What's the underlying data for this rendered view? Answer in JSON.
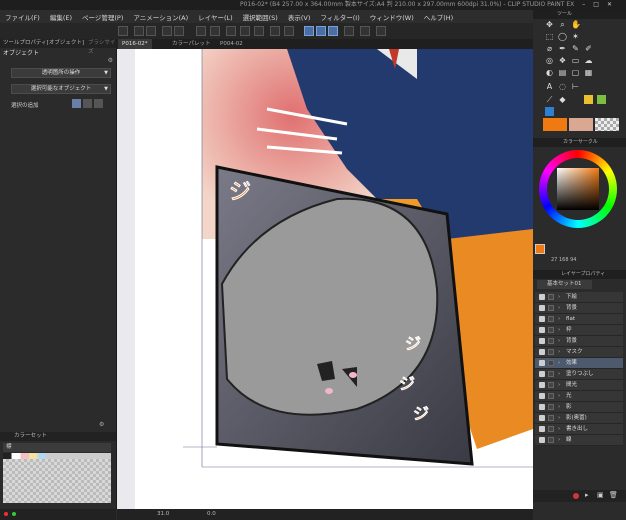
{
  "window": {
    "title": "P016-02* (B4 257.00 x 364.00mm 製本サイズ:A4 判 210.00 x 297.00mm 600dpi 31.0%) - CLIP STUDIO PAINT EX"
  },
  "menu": [
    "ファイル(F)",
    "編集(E)",
    "ページ管理(P)",
    "アニメーション(A)",
    "レイヤー(L)",
    "選択範囲(S)",
    "表示(V)",
    "フィルター(I)",
    "ウィンドウ(W)",
    "ヘルプ(H)"
  ],
  "tabs": [
    "P016-02*",
    "カラーパレット",
    "P004-02"
  ],
  "left_panel": {
    "tab_tool_property": "ツールプロパティ[オブジェクト]",
    "tab_other": "ブラシサイズ",
    "section_title": "オブジェクト",
    "dropdown1": "透明箇所の操作",
    "dropdown2": "選択可能なオブジェクト",
    "selection_add_label": "選択の追加",
    "colorset_tab": "カラーセット",
    "colorset_name": "標"
  },
  "right_panel": {
    "tool_title": "ツール",
    "color_circle_title": "カラーサークル",
    "hsv_values": "27 168 94",
    "layer_title": "レイヤープロパティ",
    "layer_set": "基本セット01",
    "layers": [
      "下絵",
      "背景",
      "flat",
      "枠",
      "背景",
      "マスク",
      "効果",
      "塗りつぶし",
      "間光",
      "光",
      "影",
      "影(奥冨)",
      "書き出し",
      "線"
    ],
    "selected_layer_index": 6
  },
  "colors": {
    "main_color": "#f07a12",
    "sub_color": "#d9a893",
    "accent": "#4a6fa5"
  },
  "status": {
    "zoom": "31.0",
    "rotation": "0.0"
  }
}
